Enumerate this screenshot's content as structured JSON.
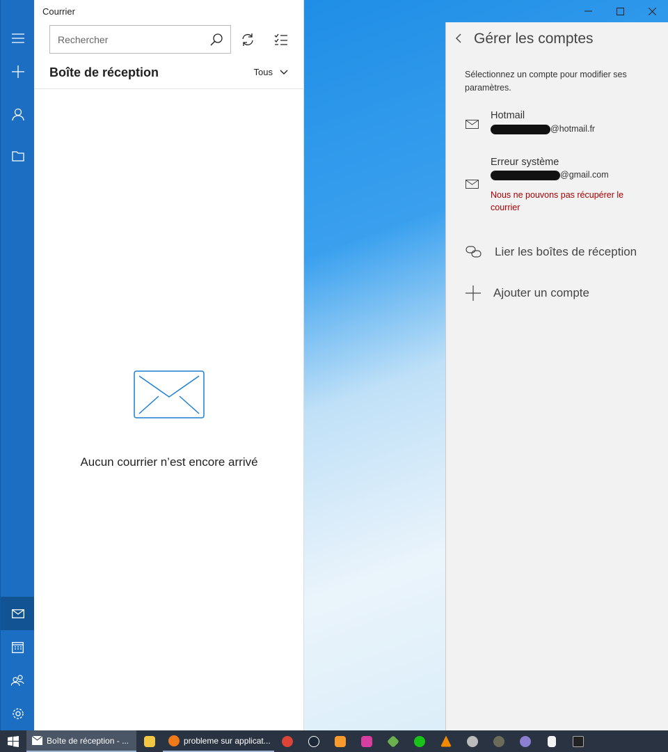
{
  "app": {
    "title": "Courrier"
  },
  "sidebar": {
    "items": [
      {
        "icon": "hamburger-icon"
      },
      {
        "icon": "plus-icon"
      },
      {
        "icon": "person-icon"
      },
      {
        "icon": "folder-icon"
      }
    ],
    "bottom": [
      {
        "icon": "mail-icon",
        "selected": true
      },
      {
        "icon": "calendar-icon"
      },
      {
        "icon": "people-icon"
      },
      {
        "icon": "gear-icon"
      }
    ]
  },
  "search": {
    "placeholder": "Rechercher"
  },
  "inbox": {
    "title": "Boîte de réception",
    "filter": "Tous",
    "empty_message": "Aucun courrier n’est encore arrivé"
  },
  "panel": {
    "title": "Gérer les comptes",
    "description": "Sélectionnez un compte pour modifier ses paramètres.",
    "accounts": [
      {
        "name": "Hotmail",
        "email_suffix": "@hotmail.fr"
      },
      {
        "name": "Erreur système",
        "email_suffix": "@gmail.com",
        "error": "Nous ne pouvons pas récupérer le courrier"
      }
    ],
    "link_inboxes": "Lier les boîtes de réception",
    "add_account": "Ajouter un compte"
  },
  "taskbar": {
    "items": [
      {
        "label": "Boîte de réception - ..."
      },
      {
        "label": "probleme sur applicat..."
      }
    ],
    "colors": {
      "accent": "#1b6ec2",
      "error": "#a80000"
    }
  }
}
